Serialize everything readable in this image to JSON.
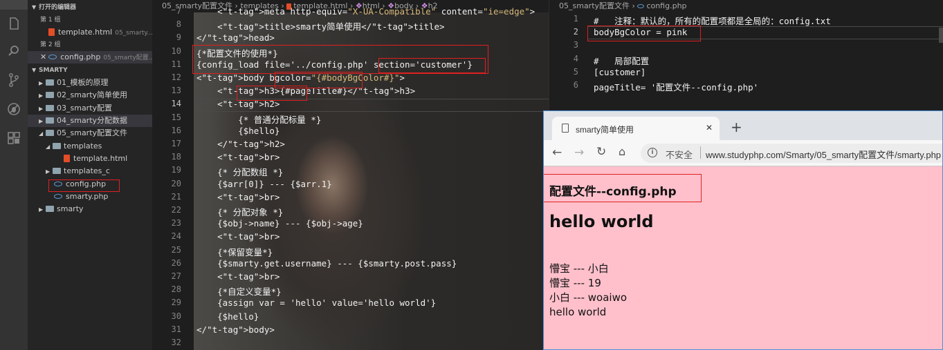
{
  "sidebar": {
    "open_editors_title": "打开的编辑器",
    "group1": "第 1 组",
    "group1_file": "template.html",
    "group1_file_path": "05_smarty...",
    "group2": "第 2 组",
    "group2_file": "config.php",
    "group2_file_path": "05_smarty配置...",
    "project_title": "SMARTY",
    "tree": [
      {
        "label": "01_模板的原理"
      },
      {
        "label": "02_smarty简单使用"
      },
      {
        "label": "03_smarty配置"
      },
      {
        "label": "04_smarty分配数据"
      },
      {
        "label": "05_smarty配置文件"
      },
      {
        "label": "templates"
      },
      {
        "label": "template.html"
      },
      {
        "label": "templates_c"
      },
      {
        "label": "config.php"
      },
      {
        "label": "smarty.php"
      },
      {
        "label": "smarty"
      }
    ]
  },
  "editor1": {
    "breadcrumb": [
      "05_smarty配置文件",
      "templates",
      "template.html",
      "html",
      "body",
      "h2"
    ],
    "line_numbers": [
      "7",
      "8",
      "9",
      "10",
      "11",
      "12",
      "13",
      "14",
      "15",
      "16",
      "17",
      "18",
      "19",
      "20",
      "21",
      "22",
      "23",
      "24",
      "25",
      "26",
      "27",
      "28",
      "29",
      "30",
      "31",
      "32"
    ],
    "lines": [
      "    <meta http-equiv=\"X-UA-Compatible\" content=\"ie=edge\">",
      "    <title>smarty简单使用</title>",
      "</head>",
      "{*配置文件的使用*}",
      "{config_load file='../config.php' section='customer'}",
      "<body bgcolor=\"{#bodyBgColor#}\">",
      "    <h3>{#pageTitle#}</h3>",
      "    <h2>",
      "        {* 普通分配标量 *}",
      "        {$hello}",
      "    </h2>",
      "    <br>",
      "    {* 分配数组 *}",
      "    {$arr[0]} --- {$arr.1}",
      "    <br>",
      "    {* 分配对象 *}",
      "    {$obj->name} --- {$obj->age}",
      "    <br>",
      "    {*保留变量*}",
      "    {$smarty.get.username} --- {$smarty.post.pass}",
      "    <br>",
      "    {*自定义变量*}",
      "    {assign var = 'hello' value='hello world'}",
      "    {$hello}",
      "</body>",
      ""
    ]
  },
  "editor2": {
    "breadcrumb": [
      "05_smarty配置文件",
      "config.php"
    ],
    "line_numbers": [
      "1",
      "2",
      "3",
      "4",
      "5",
      "6"
    ],
    "lines": [
      "#   注释：默认的，所有的配置项都是全局的：config.txt",
      "bodyBgColor = pink",
      "",
      "#   局部配置",
      "[customer]",
      "pageTitle= '配置文件--config.php'"
    ]
  },
  "browser": {
    "tab_title": "smarty简单使用",
    "close": "✕",
    "new_tab": "+",
    "security": "不安全",
    "url": "www.studyphp.com/Smarty/05_smarty配置文件/smarty.php",
    "bg_color": "#ffc0cb",
    "h3": "配置文件--config.php",
    "h2": "hello world",
    "body_lines": [
      "懵宝 --- 小白",
      "懵宝 --- 19",
      "小白 --- woaiwo",
      "hello world"
    ]
  }
}
